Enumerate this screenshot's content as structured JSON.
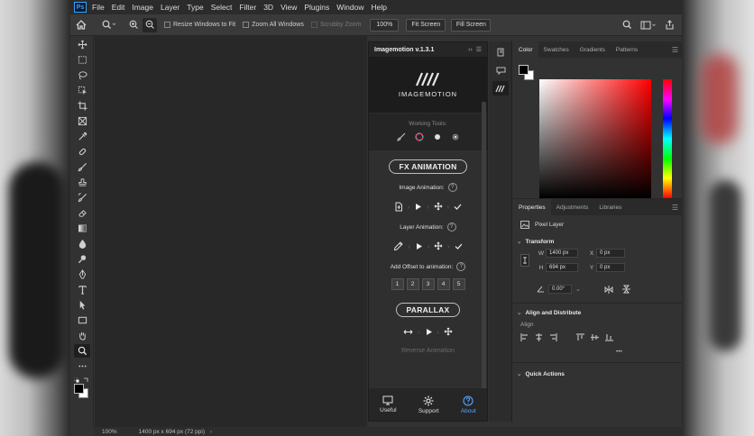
{
  "app": {
    "logo": "Ps"
  },
  "menu": [
    "File",
    "Edit",
    "Image",
    "Layer",
    "Type",
    "Select",
    "Filter",
    "3D",
    "View",
    "Plugins",
    "Window",
    "Help"
  ],
  "options": {
    "resize_windows": "Resize Windows to Fit",
    "zoom_all": "Zoom All Windows",
    "scrubby": "Scrubby Zoom",
    "zoom_value": "100%",
    "fit_screen": "Fit Screen",
    "fill_screen": "Fill Screen"
  },
  "status": {
    "zoom": "100%",
    "doc": "1400 px x 694 px (72 ppi)"
  },
  "plugin": {
    "title": "Imagemotion v.1.3.1",
    "logo_text": "IMAGEMOTION",
    "working_tools": "Working Tools:",
    "fx_animation": "FX ANIMATION",
    "image_animation": "Image Animation:",
    "layer_animation": "Layer Animation:",
    "add_offset": "Add Offset to animation:",
    "offsets": [
      "1",
      "2",
      "3",
      "4",
      "5"
    ],
    "parallax": "PARALLAX",
    "reverse": "Reverse Animation",
    "footer": {
      "useful": "Useful",
      "support": "Support",
      "about": "About"
    },
    "accent": "#58a6ff"
  },
  "color_panel": {
    "tabs": [
      "Color",
      "Swatches",
      "Gradients",
      "Patterns"
    ]
  },
  "props_panel": {
    "tabs": [
      "Properties",
      "Adjustments",
      "Libraries"
    ],
    "layer_type": "Pixel Layer",
    "transform": "Transform",
    "w_label": "W",
    "w_value": "1400 px",
    "h_label": "H",
    "h_value": "694 px",
    "x_label": "X",
    "x_value": "0 px",
    "y_label": "Y",
    "y_value": "0 px",
    "angle": "0.00°",
    "align_distribute": "Align and Distribute",
    "align": "Align",
    "more": "•••",
    "quick_actions": "Quick Actions"
  }
}
